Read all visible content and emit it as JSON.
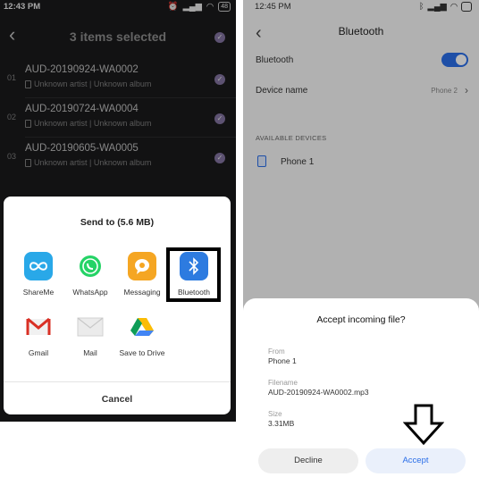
{
  "left": {
    "status_time": "12:43 PM",
    "battery": "48",
    "header_title": "3 items selected",
    "songs": [
      {
        "num": "01",
        "name": "AUD-20190924-WA0002",
        "sub": "Unknown artist | Unknown album"
      },
      {
        "num": "02",
        "name": "AUD-20190724-WA0004",
        "sub": "Unknown artist | Unknown album"
      },
      {
        "num": "03",
        "name": "AUD-20190605-WA0005",
        "sub": "Unknown artist | Unknown album"
      }
    ],
    "share_sheet": {
      "title": "Send to (5.6 MB)",
      "apps": [
        {
          "label": "ShareMe",
          "icon": "shareme-icon"
        },
        {
          "label": "WhatsApp",
          "icon": "whatsapp-icon"
        },
        {
          "label": "Messaging",
          "icon": "messaging-icon"
        },
        {
          "label": "Bluetooth",
          "icon": "bluetooth-icon"
        },
        {
          "label": "Gmail",
          "icon": "gmail-icon"
        },
        {
          "label": "Mail",
          "icon": "mail-icon"
        },
        {
          "label": "Save to Drive",
          "icon": "drive-icon"
        }
      ],
      "cancel_label": "Cancel"
    }
  },
  "right": {
    "status_time": "12:45 PM",
    "header_title": "Bluetooth",
    "bluetooth_label": "Bluetooth",
    "bluetooth_on": true,
    "device_name_label": "Device name",
    "device_name_value": "Phone 2",
    "section_label": "AVAILABLE DEVICES",
    "available_devices": [
      "Phone 1"
    ],
    "dialog": {
      "title": "Accept incoming file?",
      "from_label": "From",
      "from_value": "Phone 1",
      "filename_label": "Filename",
      "filename_value": "AUD-20190924-WA0002.mp3",
      "size_label": "Size",
      "size_value": "3.31MB",
      "decline_label": "Decline",
      "accept_label": "Accept"
    }
  },
  "colors": {
    "accent_blue": "#2a6ee8",
    "check_purple": "#8f7fb0",
    "dark_bg": "#1c1c1e"
  }
}
